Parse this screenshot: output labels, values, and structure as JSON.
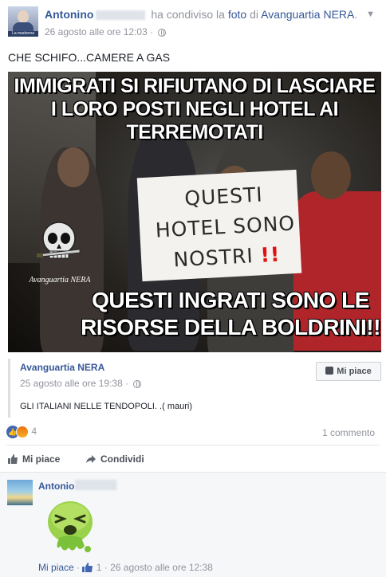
{
  "post": {
    "author": "Antonino",
    "action_text": "ha condiviso la",
    "object_link": "foto",
    "preposition": "di",
    "page_name": "Avanguartia NERA",
    "punctuation": ".",
    "timestamp": "26 agosto alle ore 12:03",
    "status_text": "CHE SCHIFO...CAMERE A GAS"
  },
  "photo": {
    "top_caption_line1": "IMMIGRATI SI RIFIUTANO DI LASCIARE",
    "top_caption_line2": "I LORO POSTI NEGLI HOTEL AI TERREMOTATI",
    "sign_line1": "QUESTI",
    "sign_line2": "HOTEL SONO",
    "sign_line3": "NOSTRI",
    "sign_exclaim": "!!",
    "bottom_caption_line1": "QUESTI INGRATI SONO LE",
    "bottom_caption_line2": "RISORSE DELLA BOLDRINI!!",
    "logo_label": "Avanguartia NERA",
    "avatar_tag": "La madonna"
  },
  "shared_post": {
    "page_name": "Avanguartia NERA",
    "timestamp": "25 agosto alle ore 19:38",
    "text": "GLI ITALIANI NELLE TENDOPOLI. .( mauri)",
    "like_button": "Mi piace"
  },
  "reactions": {
    "count": "4",
    "comments_count": "1 commento"
  },
  "actions": {
    "like": "Mi piace",
    "share": "Condividi"
  },
  "comment": {
    "author": "Antonio",
    "like_label": "Mi piace",
    "like_count": "1",
    "separator": "·",
    "timestamp": "26 agosto alle ore 12:38"
  },
  "colors": {
    "link_blue": "#365899",
    "meta_gray": "#90949c",
    "like_blue": "#4267b2"
  }
}
